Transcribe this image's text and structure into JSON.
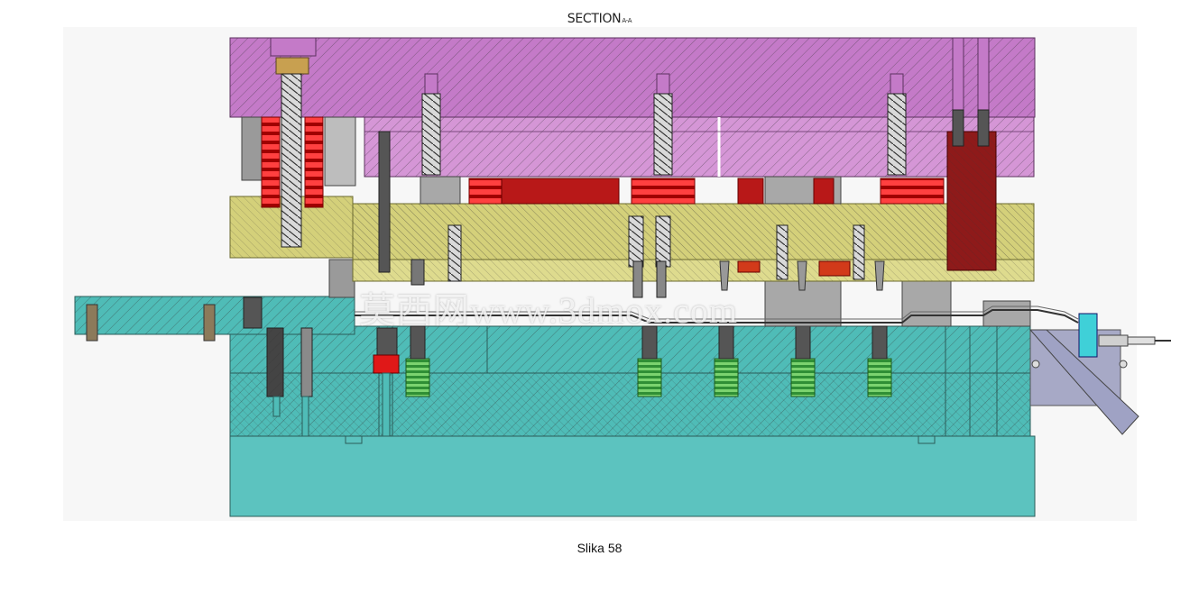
{
  "header": {
    "title": "SECTION",
    "title_suffix": "A-A"
  },
  "caption": "Slika 58",
  "watermark": "莫西网www.3dmox.com",
  "colors": {
    "upper_plate": "#c47ac8",
    "upper_plate_light": "#d596d6",
    "stripper_plate": "#d4d07a",
    "lower_plate": "#4fbcb7",
    "base_plate": "#5cc3bf",
    "spring_red": "#d81c1c",
    "dark_red": "#8e1a1a",
    "spring_green": "#4caf50",
    "steel_gray": "#9a9a9a",
    "bracket": "#a7a9c6",
    "sensor": "#3fd0d8"
  },
  "components": [
    "upper-die-plate",
    "punch-holder-plate",
    "stripper-plate",
    "die-plate",
    "lower-die-shoe",
    "feed-guide-plate",
    "guide-pillar",
    "stripper-springs",
    "pilot-punches",
    "ejector-springs",
    "exit-chute",
    "proximity-sensor"
  ]
}
